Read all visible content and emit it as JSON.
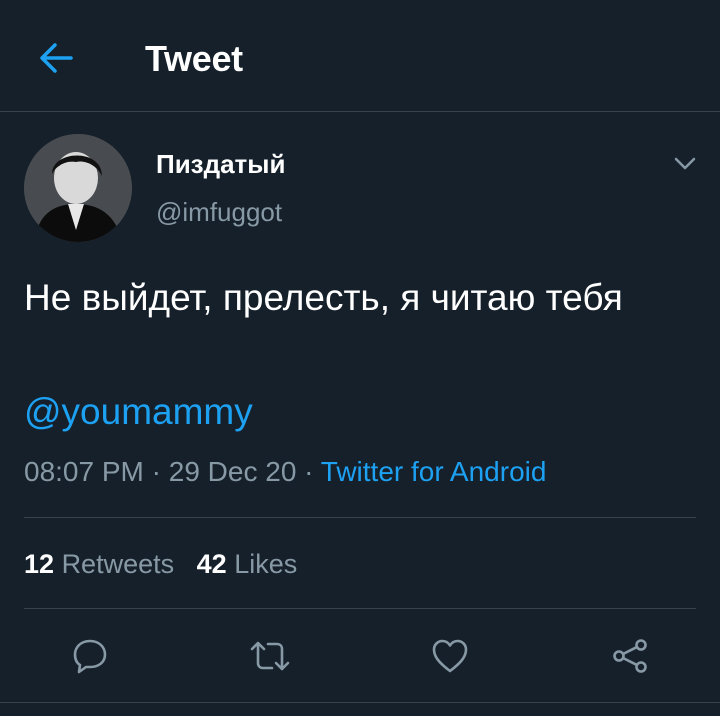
{
  "header": {
    "title": "Tweet"
  },
  "tweet": {
    "display_name": "Пиздатый",
    "handle": "@imfuggot",
    "text": "Не выйдет, прелесть, я читаю тебя",
    "mention": "@youmammy",
    "time": "08:07 PM",
    "separator": " · ",
    "date": "29 Dec 20",
    "source": "Twitter for Android"
  },
  "stats": {
    "retweets_count": "12",
    "retweets_label": "Retweets",
    "likes_count": "42",
    "likes_label": "Likes"
  },
  "icons": {
    "back": "arrow-left-icon",
    "menu": "chevron-down-icon",
    "reply": "reply-icon",
    "retweet": "retweet-icon",
    "like": "heart-icon",
    "share": "share-icon"
  },
  "colors": {
    "background": "#15202b",
    "accent": "#1da1f2",
    "secondary_text": "#8899a6",
    "divider": "#38444d"
  }
}
